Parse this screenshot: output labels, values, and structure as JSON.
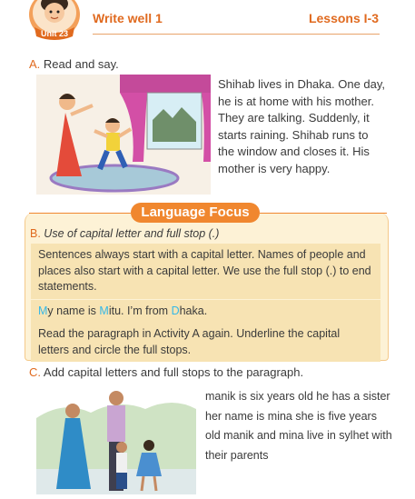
{
  "header": {
    "unit_label": "Unit 23",
    "title": "Write well 1",
    "lessons": "Lessons I-3",
    "accent_color": "#e06a1f"
  },
  "section_a": {
    "letter": "A.",
    "heading": "Read and say.",
    "story": "Shihab lives in Dhaka. One day, he is at home with his mother. They are talking. Suddenly, it starts raining. Shihab runs to the window and closes it. His mother is very happy."
  },
  "language_focus": {
    "tab_label": "Language Focus",
    "section_b": {
      "letter": "B.",
      "heading": "Use of capital letter and full stop (.)",
      "rule_text": "Sentences always start with a capital letter. Names of people and places also start with a capital letter. We use the full stop (.) to end statements.",
      "example": {
        "cap1": "M",
        "rest1": "y name is ",
        "cap2": "M",
        "rest2": "itu. I’m from ",
        "cap3": "D",
        "rest3": "haka."
      },
      "instruction": "Read the paragraph in Activity A again. Underline the capital letters and circle the full stops."
    }
  },
  "section_c": {
    "letter": "C.",
    "heading": "Add capital letters and full stops to the paragraph.",
    "paragraph": "manik is six years old he has a sister her name is mina she is five years old manik and mina live in sylhet with their parents"
  }
}
